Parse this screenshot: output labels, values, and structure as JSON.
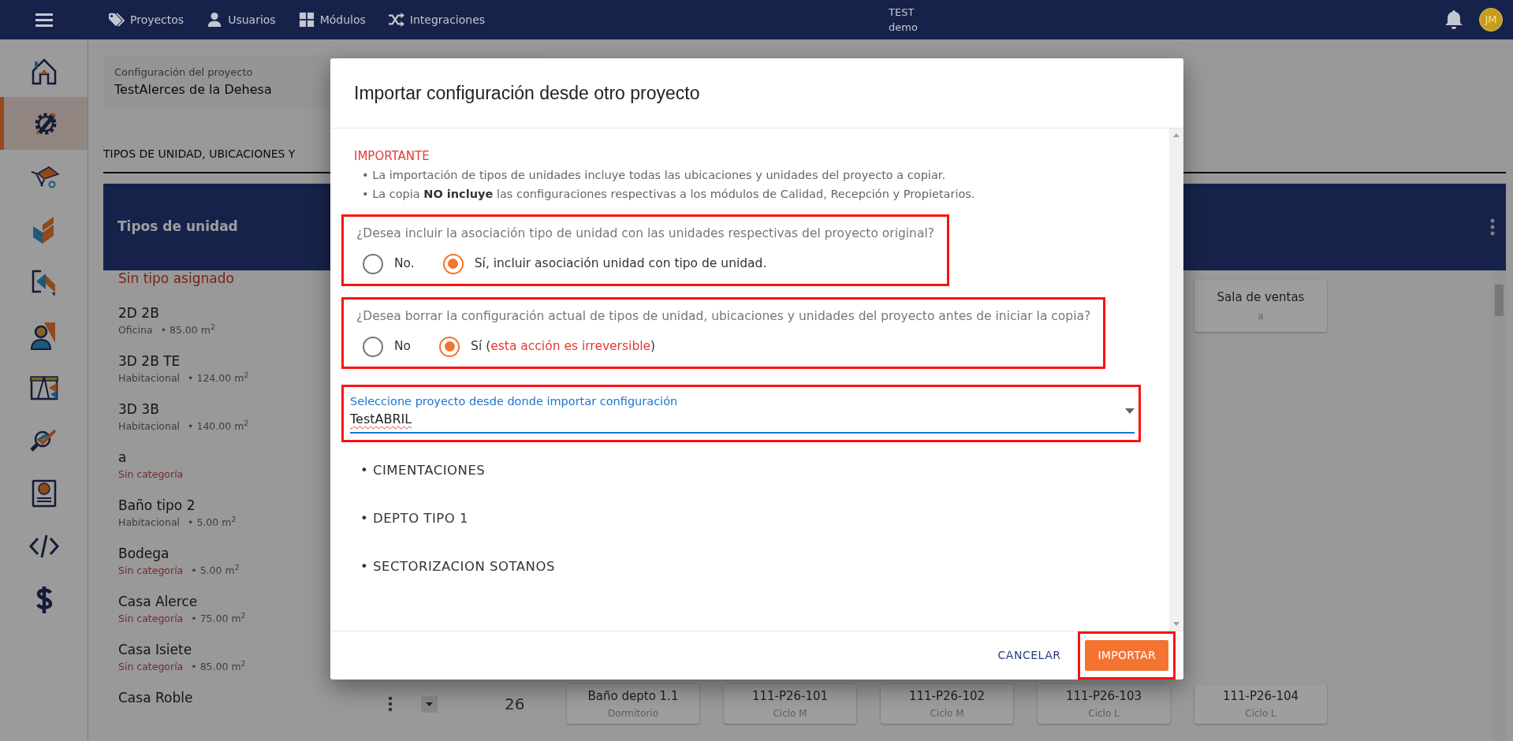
{
  "topbar": {
    "nav": [
      {
        "label": "Proyectos"
      },
      {
        "label": "Usuarios"
      },
      {
        "label": "Módulos"
      },
      {
        "label": "Integraciones"
      }
    ],
    "company": "TEST",
    "user": "demo",
    "avatar": "JM"
  },
  "sidebar": {
    "items": [
      {
        "selected": false
      },
      {
        "selected": true
      },
      {
        "selected": false
      },
      {
        "selected": false
      },
      {
        "selected": false
      },
      {
        "selected": false
      },
      {
        "selected": false
      },
      {
        "selected": false
      },
      {
        "selected": false
      },
      {
        "selected": false
      },
      {
        "selected": false
      }
    ]
  },
  "project": {
    "label": "Configuración del proyecto",
    "name": "TestAlerces de la Dehesa"
  },
  "tab": {
    "label": "TIPOS DE UNIDAD, UBICACIONES Y"
  },
  "unit_types": {
    "title": "Tipos de unidad",
    "unassigned": "Sin tipo asignado",
    "items": [
      {
        "name": "2D 2B",
        "category": "Oficina",
        "uncategorized": false,
        "area": "• 85.00 m$^{2}$"
      },
      {
        "name": "3D 2B TE",
        "category": "Habitacional",
        "uncategorized": false,
        "area": "• 124.00 m$^{2}$"
      },
      {
        "name": "3D 3B",
        "category": "Habitacional",
        "uncategorized": false,
        "area": "• 140.00 m$^{2}$"
      },
      {
        "name": "a",
        "category": "Sin categoría",
        "uncategorized": true
      },
      {
        "name": "Baño tipo 2",
        "category": "Habitacional",
        "uncategorized": false,
        "area": "• 5.00 m$^{2}$"
      },
      {
        "name": "Bodega",
        "category": "Sin categoría",
        "uncategorized": true,
        "area": "• 5.00 m$^{2}$"
      },
      {
        "name": "Casa Alerce",
        "category": "Sin categoría",
        "uncategorized": true,
        "area": "• 75.00 m$^{2}$"
      },
      {
        "name": "Casa Isiete",
        "category": "Sin categoría",
        "uncategorized": true,
        "area": "• 85.00 m$^{2}$"
      },
      {
        "name": "Casa Roble"
      }
    ]
  },
  "units": {
    "top": [
      {
        "name": "Sala de ventas",
        "type": "a"
      }
    ],
    "row_label": "26",
    "bottom": [
      {
        "name": "Baño depto 1.1",
        "type": "Dormitorio"
      },
      {
        "name": "111-P26-101",
        "type": "Ciclo M"
      },
      {
        "name": "111-P26-102",
        "type": "Ciclo M"
      },
      {
        "name": "111-P26-103",
        "type": "Ciclo L"
      },
      {
        "name": "111-P26-104",
        "type": "Ciclo L"
      }
    ]
  },
  "dialog": {
    "title": "Importar configuración desde otro proyecto",
    "notice": {
      "heading": "IMPORTANTE",
      "bullets": [
        "• La importación de tipos de unidades incluye todas las ubicaciones y unidades del proyecto a copiar.",
        "• La copia **NO incluye** las configuraciones respectivas a los módulos de Calidad, Recepción y Propietarios."
      ]
    },
    "questions": [
      {
        "highlighted": true,
        "text": "¿Desea incluir la asociación tipo de unidad con las unidades respectivas del proyecto original?",
        "options": [
          {
            "selected": false,
            "parts": [
              {
                "kind": "plain",
                "text": "No."
              }
            ]
          },
          {
            "selected": true,
            "parts": [
              {
                "kind": "plain",
                "text": "Sí, incluir asociación unidad con tipo de unidad."
              }
            ]
          }
        ]
      },
      {
        "highlighted": true,
        "text": "¿Desea borrar la configuración actual de tipos de unidad, ubicaciones y unidades del proyecto antes de iniciar la copia?",
        "options": [
          {
            "selected": false,
            "parts": [
              {
                "kind": "plain",
                "text": "No"
              }
            ]
          },
          {
            "selected": true,
            "parts": [
              {
                "kind": "plain",
                "text": "Sí ("
              },
              {
                "kind": "warning",
                "text": "esta acción es irreversible"
              },
              {
                "kind": "plain",
                "text": ")"
              }
            ]
          }
        ]
      }
    ],
    "select": {
      "highlighted": true,
      "label": "Seleccione proyecto desde donde importar configuración",
      "value": "TestABRIL"
    },
    "projects": [
      "• CIMENTACIONES",
      "• DEPTO TIPO 1",
      "• SECTORIZACION SOTANOS"
    ],
    "buttons": [
      {
        "kind": "text",
        "label": "CANCELAR",
        "highlighted": false
      },
      {
        "kind": "primary",
        "label": "IMPORTAR",
        "highlighted": true
      }
    ]
  }
}
